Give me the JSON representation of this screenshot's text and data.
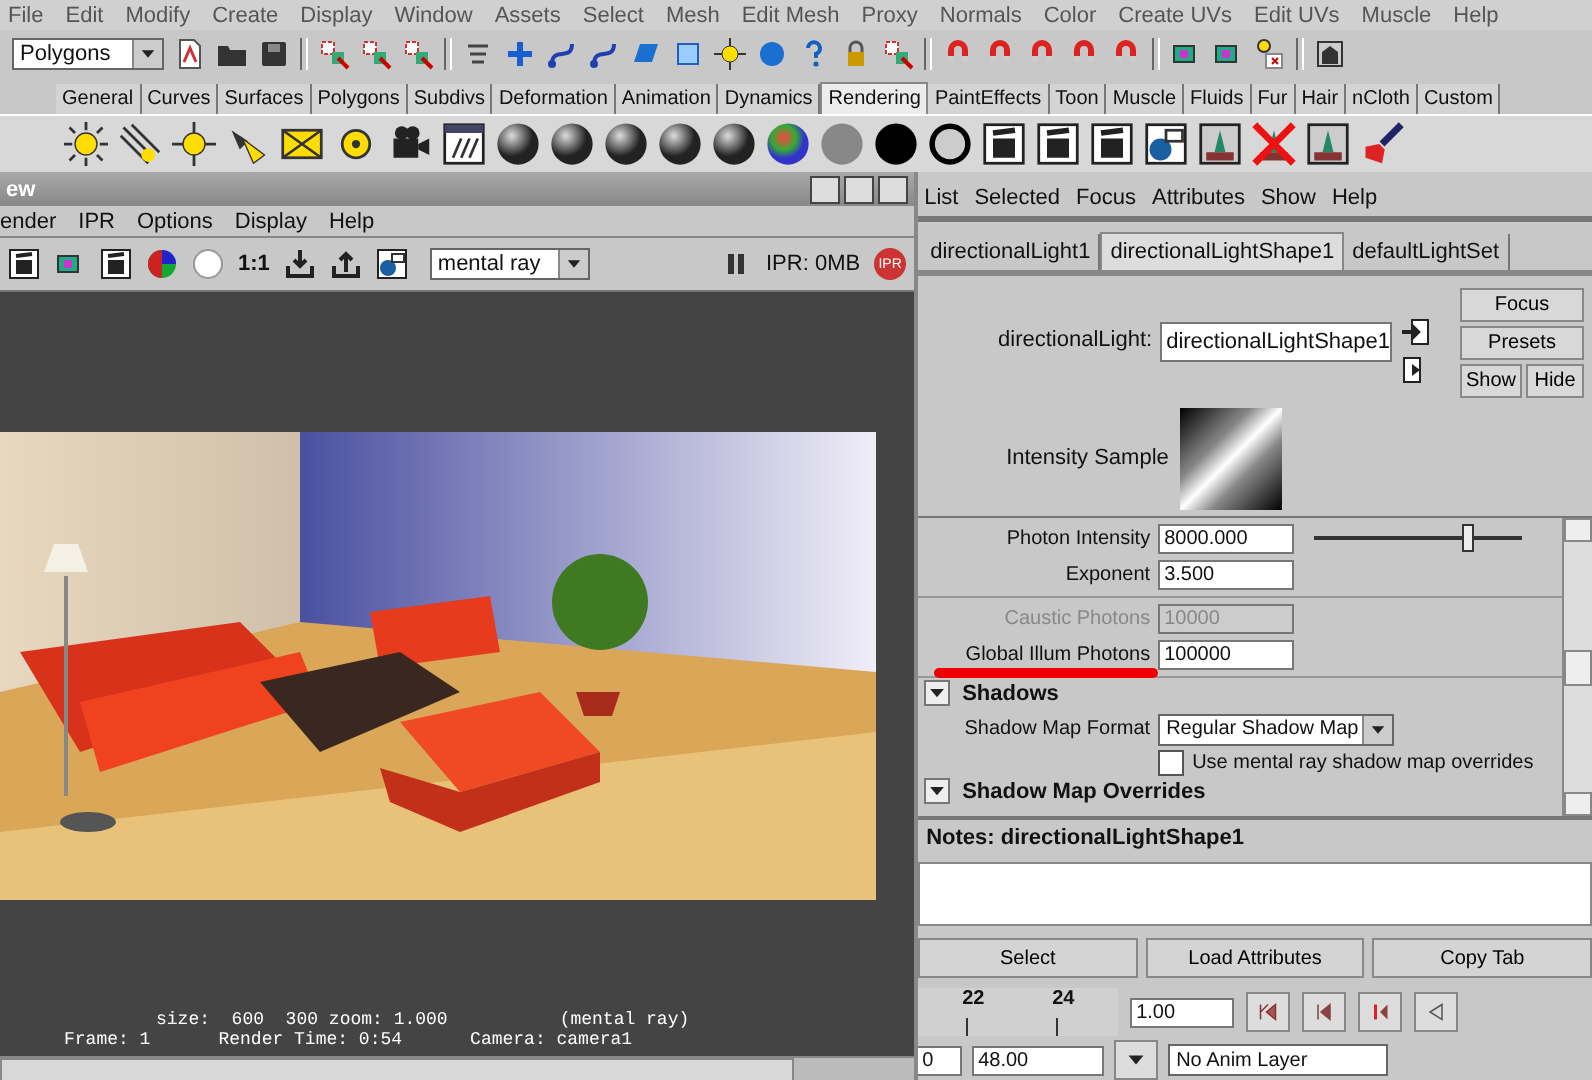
{
  "menu_bar": [
    "File",
    "Edit",
    "Modify",
    "Create",
    "Display",
    "Window",
    "Assets",
    "Select",
    "Mesh",
    "Edit Mesh",
    "Proxy",
    "Normals",
    "Color",
    "Create UVs",
    "Edit UVs",
    "Muscle",
    "Help"
  ],
  "status_line": {
    "menu_set": "Polygons"
  },
  "shelf_tabs": [
    {
      "label": "General",
      "selected": false
    },
    {
      "label": "Curves",
      "selected": false
    },
    {
      "label": "Surfaces",
      "selected": false
    },
    {
      "label": "Polygons",
      "selected": false
    },
    {
      "label": "Subdivs",
      "selected": false
    },
    {
      "label": "Deformation",
      "selected": false
    },
    {
      "label": "Animation",
      "selected": false
    },
    {
      "label": "Dynamics",
      "selected": false
    },
    {
      "label": "Rendering",
      "selected": true
    },
    {
      "label": "PaintEffects",
      "selected": false
    },
    {
      "label": "Toon",
      "selected": false
    },
    {
      "label": "Muscle",
      "selected": false
    },
    {
      "label": "Fluids",
      "selected": false
    },
    {
      "label": "Fur",
      "selected": false
    },
    {
      "label": "Hair",
      "selected": false
    },
    {
      "label": "nCloth",
      "selected": false
    },
    {
      "label": "Custom",
      "selected": false
    }
  ],
  "render_view": {
    "title": "ew",
    "menu": [
      "ender",
      "IPR",
      "Options",
      "Display",
      "Help"
    ],
    "zoom_label": "1:1",
    "renderer": "mental ray",
    "ipr_status": "IPR: 0MB",
    "ipr_badge": "IPR",
    "render": {
      "kind": "picture"
    },
    "info_lines": [
      [
        "size:  600  300 zoom: 1.000",
        "(mental ray)"
      ],
      [
        "Frame: 1",
        "Render Time: 0:54",
        "Camera: camera1"
      ]
    ]
  },
  "attribute_editor": {
    "menu": [
      "List",
      "Selected",
      "Focus",
      "Attributes",
      "Show",
      "Help"
    ],
    "tabs": [
      {
        "label": "directionalLight1",
        "selected": false
      },
      {
        "label": "directionalLightShape1",
        "selected": true
      },
      {
        "label": "defaultLightSet",
        "selected": false
      }
    ],
    "node_label": "directionalLight:",
    "node_name": "directionalLightShape1",
    "side_buttons": [
      "Focus",
      "Presets",
      "Show",
      "Hide"
    ],
    "sample_label": "Intensity Sample",
    "attribute_groups": [
      [
        {
          "kind": "slider",
          "label": "Photon Intensity",
          "value": "8000.000",
          "level": 0.74,
          "disabled": false,
          "highlighted": false
        },
        {
          "kind": "field",
          "label": "Exponent",
          "value": "3.500",
          "disabled": false,
          "highlighted": false
        }
      ],
      [
        {
          "kind": "field",
          "label": "Caustic Photons",
          "value": "10000",
          "disabled": true,
          "highlighted": false
        },
        {
          "kind": "field",
          "label": "Global Illum Photons",
          "value": "100000",
          "disabled": false,
          "highlighted": true
        }
      ]
    ],
    "sections": [
      {
        "title": "Shadows",
        "expanded": true,
        "rows": [
          {
            "kind": "dropdown",
            "label": "Shadow Map Format",
            "value": "Regular Shadow Map"
          },
          {
            "kind": "checkbox",
            "label": "Use mental ray shadow map overrides",
            "checked": false
          }
        ]
      },
      {
        "title": "Shadow Map Overrides",
        "expanded": true
      }
    ],
    "notes_title": "Notes:  directionalLightShape1",
    "bottom_buttons": [
      "Select",
      "Load Attributes",
      "Copy Tab"
    ]
  },
  "time_slider": {
    "ticks": [
      "22",
      "24"
    ],
    "current_time": "1.00"
  },
  "range_slider": {
    "start": "0",
    "end": "48.00",
    "anim_layer": "No Anim Layer"
  }
}
